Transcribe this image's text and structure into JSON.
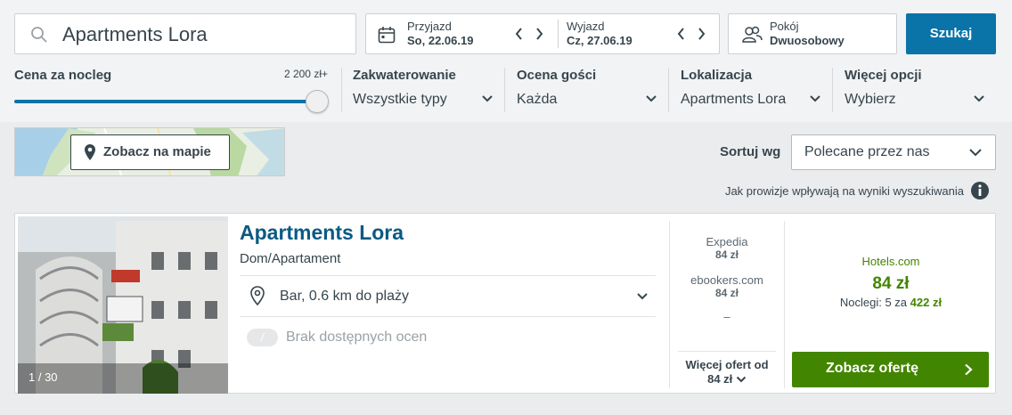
{
  "search": {
    "query": "Apartments Lora",
    "button": "Szukaj"
  },
  "dates": {
    "checkin_label": "Przyjazd",
    "checkin_value": "So, 22.06.19",
    "checkout_label": "Wyjazd",
    "checkout_value": "Cz, 27.06.19"
  },
  "room": {
    "label": "Pokój",
    "value": "Dwuosobowy"
  },
  "filters": {
    "price": {
      "label": "Cena za nocleg",
      "max": "2 200 zł+",
      "slider_fraction": 1.0
    },
    "accommodation": {
      "label": "Zakwaterowanie",
      "value": "Wszystkie typy"
    },
    "rating": {
      "label": "Ocena gości",
      "value": "Każda"
    },
    "location": {
      "label": "Lokalizacja",
      "value": "Apartments Lora"
    },
    "more": {
      "label": "Więcej opcji",
      "value": "Wybierz"
    }
  },
  "map": {
    "button": "Zobacz na mapie"
  },
  "sort": {
    "label": "Sortuj wg",
    "value": "Polecane przez nas"
  },
  "commission_note": "Jak prowizje wpływają na wyniki wyszukiwania",
  "result": {
    "photo_counter": "1 / 30",
    "name": "Apartments Lora",
    "type": "Dom/Apartament",
    "location": "Bar, 0.6 km do plaży",
    "rating_badge": "/",
    "rating_text": "Brak dostępnych ocen",
    "providers": [
      {
        "name": "Expedia",
        "price": "84 zł"
      },
      {
        "name": "ebookers.com",
        "price": "84 zł"
      }
    ],
    "dash": "–",
    "more_offers_line1": "Więcej ofert od",
    "more_offers_line2": "84 zł",
    "best_provider": "Hotels.com",
    "best_price": "84 zł",
    "nights_prefix": "Noclegi: 5 za",
    "nights_total": "422 zł",
    "deal_button": "Zobacz ofertę"
  },
  "colors": {
    "accent": "#0a73a8",
    "deal": "#428500",
    "title": "#0a5a85"
  }
}
